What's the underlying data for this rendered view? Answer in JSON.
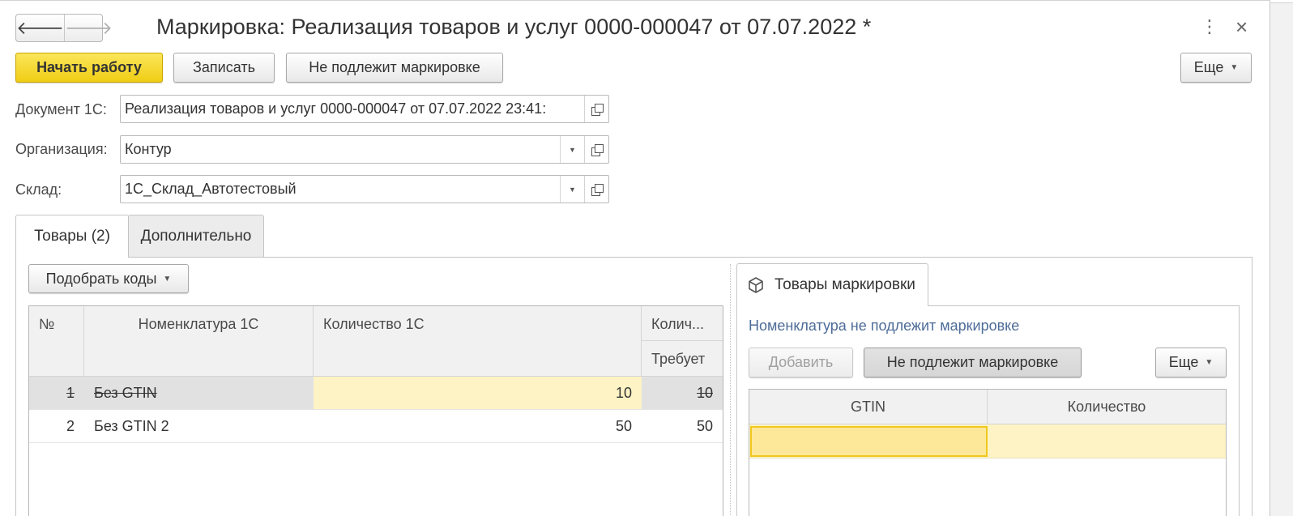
{
  "window": {
    "title": "Маркировка: Реализация товаров и услуг 0000-000047 от 07.07.2022 *",
    "back_icon": "arrow-left-icon",
    "forward_icon": "arrow-right-icon",
    "menu_icon": "more-vertical-icon",
    "close_icon": "close-icon",
    "more_glyph": "⋮",
    "close_glyph": "×",
    "back_glyph": "🡐",
    "forward_glyph": "🡒"
  },
  "toolbar": {
    "start_label": "Начать работу",
    "save_label": "Записать",
    "not_marking_label": "Не подлежит маркировке",
    "more_label": "Еще"
  },
  "form": {
    "document_label": "Документ 1С:",
    "document_value": "Реализация товаров и услуг 0000-000047 от 07.07.2022 23:41:",
    "org_label": "Организация:",
    "org_value": "Контур",
    "warehouse_label": "Склад:",
    "warehouse_value": "1С_Склад_Автотестовый"
  },
  "tabs": [
    {
      "label": "Товары (2)",
      "active": true
    },
    {
      "label": "Дополнительно",
      "active": false
    }
  ],
  "goods": {
    "pick_codes_label": "Подобрать коды",
    "columns": {
      "num": "№",
      "nomenclature": "Номенклатура 1С",
      "qty": "Количество 1С",
      "qty_short": "Колич...",
      "requires": "Требует"
    },
    "rows": [
      {
        "num": "1",
        "name": "Без GTIN",
        "qty": "10",
        "required": "10",
        "deleted": true
      },
      {
        "num": "2",
        "name": "Без GTIN 2",
        "qty": "50",
        "required": "50",
        "deleted": false
      }
    ]
  },
  "marking": {
    "tab_label": "Товары маркировки",
    "tab_icon": "cube-icon",
    "status_link": "Номенклатура не подлежит маркировке",
    "add_label": "Добавить",
    "not_marking_label": "Не подлежит маркировке",
    "more_label": "Еще",
    "columns": {
      "gtin": "GTIN",
      "qty": "Количество"
    }
  },
  "colors": {
    "primary_button": "#f4d52a",
    "selected_cell": "#fdf3c4",
    "link": "#4e6c98"
  }
}
